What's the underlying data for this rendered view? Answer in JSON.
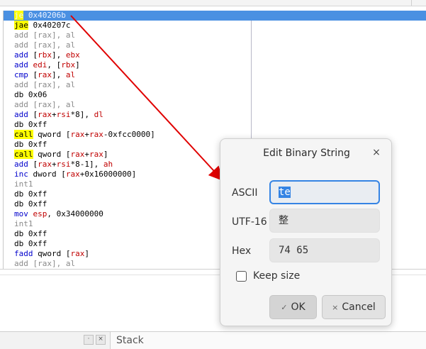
{
  "disassembly": {
    "rows": [
      {
        "m": "je",
        "o": " 0x40206b",
        "mc": "jmp",
        "sel": true
      },
      {
        "m": "jae",
        "o": " 0x40207c",
        "mc": "jmp"
      },
      {
        "m": "add",
        "o": " [rax], al",
        "mc": "dim",
        "oc": "dim"
      },
      {
        "m": "add",
        "o": " [rax], al",
        "mc": "dim",
        "oc": "dim"
      },
      {
        "m": "add",
        "o": " [rbx], ebx",
        "mc": "arith"
      },
      {
        "m": "add",
        "o": " edi, [rbx]",
        "mc": "arith"
      },
      {
        "m": "cmp",
        "o": " [rax], al",
        "mc": "arith"
      },
      {
        "m": "add",
        "o": " [rax], al",
        "mc": "dim",
        "oc": "dim"
      },
      {
        "m": "db",
        "o": " 0x06",
        "mc": "db"
      },
      {
        "m": "add",
        "o": " [rax], al",
        "mc": "dim",
        "oc": "dim"
      },
      {
        "m": "add",
        "o": " [rax+rsi*8], dl",
        "mc": "arith"
      },
      {
        "m": "db",
        "o": " 0xff",
        "mc": "db"
      },
      {
        "m": "call",
        "o": " qword [rax+rax-0xfcc0000]",
        "mc": "call"
      },
      {
        "m": "db",
        "o": " 0xff",
        "mc": "db"
      },
      {
        "m": "call",
        "o": " qword [rax+rax]",
        "mc": "call"
      },
      {
        "m": "add",
        "o": " [rax+rsi*8-1], ah",
        "mc": "arith"
      },
      {
        "m": "inc",
        "o": " dword [rax+0x16000000]",
        "mc": "arith"
      },
      {
        "m": "int1",
        "o": "",
        "mc": "dim"
      },
      {
        "m": "db",
        "o": " 0xff",
        "mc": "db"
      },
      {
        "m": "db",
        "o": " 0xff",
        "mc": "db"
      },
      {
        "m": "mov",
        "o": " esp, 0x34000000",
        "mc": "arith"
      },
      {
        "m": "int1",
        "o": "",
        "mc": "dim"
      },
      {
        "m": "db",
        "o": " 0xff",
        "mc": "db"
      },
      {
        "m": "db",
        "o": " 0xff",
        "mc": "db"
      },
      {
        "m": "fadd",
        "o": " qword [rax]",
        "mc": "arith"
      },
      {
        "m": "add",
        "o": " [rax], al",
        "mc": "dim",
        "oc": "dim"
      }
    ]
  },
  "bottom_bar": {
    "btn1": "·",
    "btn2": "×",
    "stack_tab": "Stack"
  },
  "dialog": {
    "title": "Edit Binary String",
    "close": "×",
    "ascii_label": "ASCII",
    "ascii_value": "te",
    "utf16_label": "UTF-16",
    "utf16_value": "整",
    "hex_label": "Hex",
    "hex_value": "74 65",
    "keep_size_label": "Keep size",
    "keep_size_checked": false,
    "ok_icon": "✓",
    "ok_label": "OK",
    "cancel_icon": "×",
    "cancel_label": "Cancel"
  },
  "colors": {
    "selection": "#4a90e2",
    "focus": "#3584e4",
    "jump_highlight": "#ffff00",
    "arrow": "#e00000"
  }
}
